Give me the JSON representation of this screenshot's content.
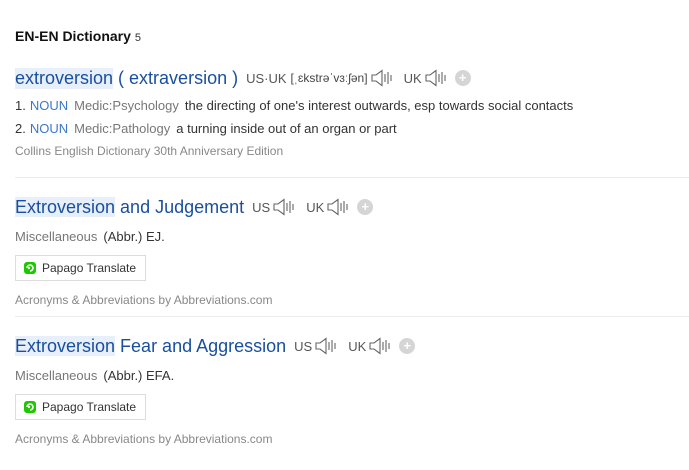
{
  "header": {
    "title": "EN-EN Dictionary",
    "count": "5"
  },
  "pron_labels": {
    "us": "US",
    "uk": "UK",
    "us_uk": "US·UK"
  },
  "entry1": {
    "word": "extroversion",
    "alt": "( extraversion )",
    "ipa": "[ˌɛkstrəˈvɜːʃən]",
    "definitions": [
      {
        "num": "1.",
        "pos": "NOUN",
        "domain": "Medic:Psychology",
        "text": "the directing of one's interest outwards, esp towards social contacts"
      },
      {
        "num": "2.",
        "pos": "NOUN",
        "domain": "Medic:Pathology",
        "text": "a turning inside out of an organ or part"
      }
    ],
    "source": "Collins English Dictionary 30th Anniversary Edition"
  },
  "entry2": {
    "word_hl": "Extroversion",
    "word_rest": " and Judgement",
    "category": "Miscellaneous",
    "abbr": "(Abbr.) EJ.",
    "button": "Papago Translate",
    "source": "Acronyms & Abbreviations by Abbreviations.com"
  },
  "entry3": {
    "word_hl": "Extroversion",
    "word_rest": " Fear and Aggression",
    "category": "Miscellaneous",
    "abbr": "(Abbr.) EFA.",
    "button": "Papago Translate",
    "source": "Acronyms & Abbreviations by Abbreviations.com"
  },
  "colors": {
    "link": "#1a4fa0",
    "pos": "#3b78c9",
    "highlight": "#e6effa",
    "papago": "#1ec800"
  }
}
